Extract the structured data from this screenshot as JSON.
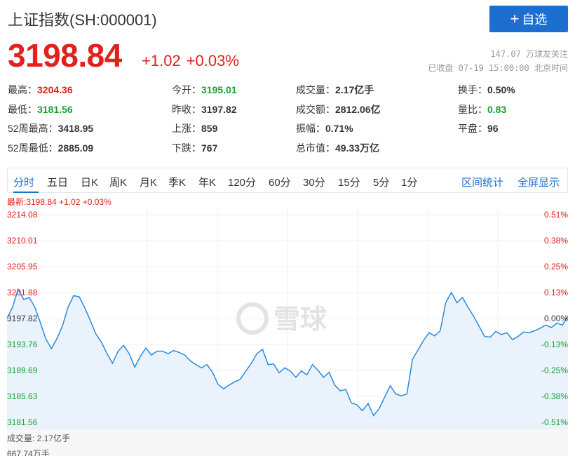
{
  "header": {
    "title": "上证指数(SH:000001)",
    "add_button": "自选",
    "price": "3198.84",
    "change": "+1.02",
    "change_pct": "+0.03%",
    "followers": "147.07 万球友关注",
    "status": "已收盘 07-19 15:00:00 北京时间"
  },
  "stats": [
    [
      {
        "label": "最高：",
        "value": "3204.36",
        "color": "red"
      },
      {
        "label": "今开：",
        "value": "3195.01",
        "color": "green"
      },
      {
        "label": "成交量：",
        "value": "2.17亿手",
        "color": "dark"
      },
      {
        "label": "换手：",
        "value": "0.50%",
        "color": "dark"
      }
    ],
    [
      {
        "label": "最低：",
        "value": "3181.56",
        "color": "green"
      },
      {
        "label": "昨收：",
        "value": "3197.82",
        "color": "dark"
      },
      {
        "label": "成交额：",
        "value": "2812.06亿",
        "color": "dark"
      },
      {
        "label": "量比：",
        "value": "0.83",
        "color": "green"
      }
    ],
    [
      {
        "label": "52周最高：",
        "value": "3418.95",
        "color": "dark"
      },
      {
        "label": "上涨：",
        "value": "859",
        "color": "dark"
      },
      {
        "label": "振幅：",
        "value": "0.71%",
        "color": "dark"
      },
      {
        "label": "平盘：",
        "value": "96",
        "color": "dark"
      }
    ],
    [
      {
        "label": "52周最低：",
        "value": "2885.09",
        "color": "dark"
      },
      {
        "label": "下跌：",
        "value": "767",
        "color": "dark"
      },
      {
        "label": "总市值：",
        "value": "49.33万亿",
        "color": "dark"
      }
    ]
  ],
  "tabs": [
    "分时",
    "五日",
    "日K",
    "周K",
    "月K",
    "季K",
    "年K",
    "120分",
    "60分",
    "30分",
    "15分",
    "5分",
    "1分"
  ],
  "active_tab": "分时",
  "tab_links": [
    "区间统计",
    "全屏显示"
  ],
  "latest": "最新:3198.84 +1.02 +0.03%",
  "watermark": "雪球",
  "volume": {
    "label": "成交量: 2.17亿手",
    "max": "667.74万手"
  },
  "colors": {
    "up": "#e0211c",
    "down": "#17a02f",
    "accent": "#1c6fd1",
    "line": "#2a8ae0",
    "fill": "#eaf3fc"
  },
  "chart_data": {
    "type": "area",
    "y_left_ticks": [
      "3214.08",
      "3210.01",
      "3205.95",
      "3201.88",
      "3197.82",
      "3193.76",
      "3189.69",
      "3185.63",
      "3181.56"
    ],
    "y_right_ticks": [
      "0.51%",
      "0.38%",
      "0.25%",
      "0.13%",
      "0.00%",
      "-0.13%",
      "-0.25%",
      "-0.38%",
      "-0.51%"
    ],
    "ylim": [
      3181.56,
      3214.08
    ],
    "baseline": 3197.82,
    "grid": true,
    "values": [
      3197.8,
      3199.6,
      3202.4,
      3200.8,
      3201.1,
      3199.6,
      3197.2,
      3194.6,
      3193.1,
      3194.7,
      3196.7,
      3199.6,
      3201.4,
      3201.2,
      3199.5,
      3197.5,
      3195.4,
      3194.1,
      3192.3,
      3190.8,
      3192.7,
      3193.6,
      3192.3,
      3190.2,
      3191.9,
      3193.2,
      3192.1,
      3192.7,
      3192.7,
      3192.3,
      3192.8,
      3192.5,
      3192.1,
      3191.2,
      3190.6,
      3190.1,
      3190.6,
      3189.4,
      3187.5,
      3186.8,
      3187.4,
      3187.9,
      3188.3,
      3189.6,
      3190.8,
      3192.3,
      3193.0,
      3190.6,
      3190.7,
      3189.3,
      3190.1,
      3189.6,
      3188.6,
      3189.6,
      3189.0,
      3190.6,
      3189.7,
      3188.6,
      3189.4,
      3187.4,
      3186.5,
      3186.7,
      3184.6,
      3184.3,
      3183.4,
      3184.5,
      3182.6,
      3183.7,
      3185.5,
      3187.3,
      3186.0,
      3185.7,
      3186.0,
      3191.4,
      3192.9,
      3194.4,
      3195.6,
      3195.1,
      3195.9,
      3200.3,
      3201.9,
      3200.3,
      3201.1,
      3199.6,
      3198.2,
      3196.6,
      3195.0,
      3194.9,
      3195.8,
      3195.3,
      3195.6,
      3194.5,
      3195.0,
      3195.7,
      3195.6,
      3195.9,
      3196.3,
      3196.8,
      3196.4,
      3197.1,
      3196.8,
      3198.2
    ]
  }
}
